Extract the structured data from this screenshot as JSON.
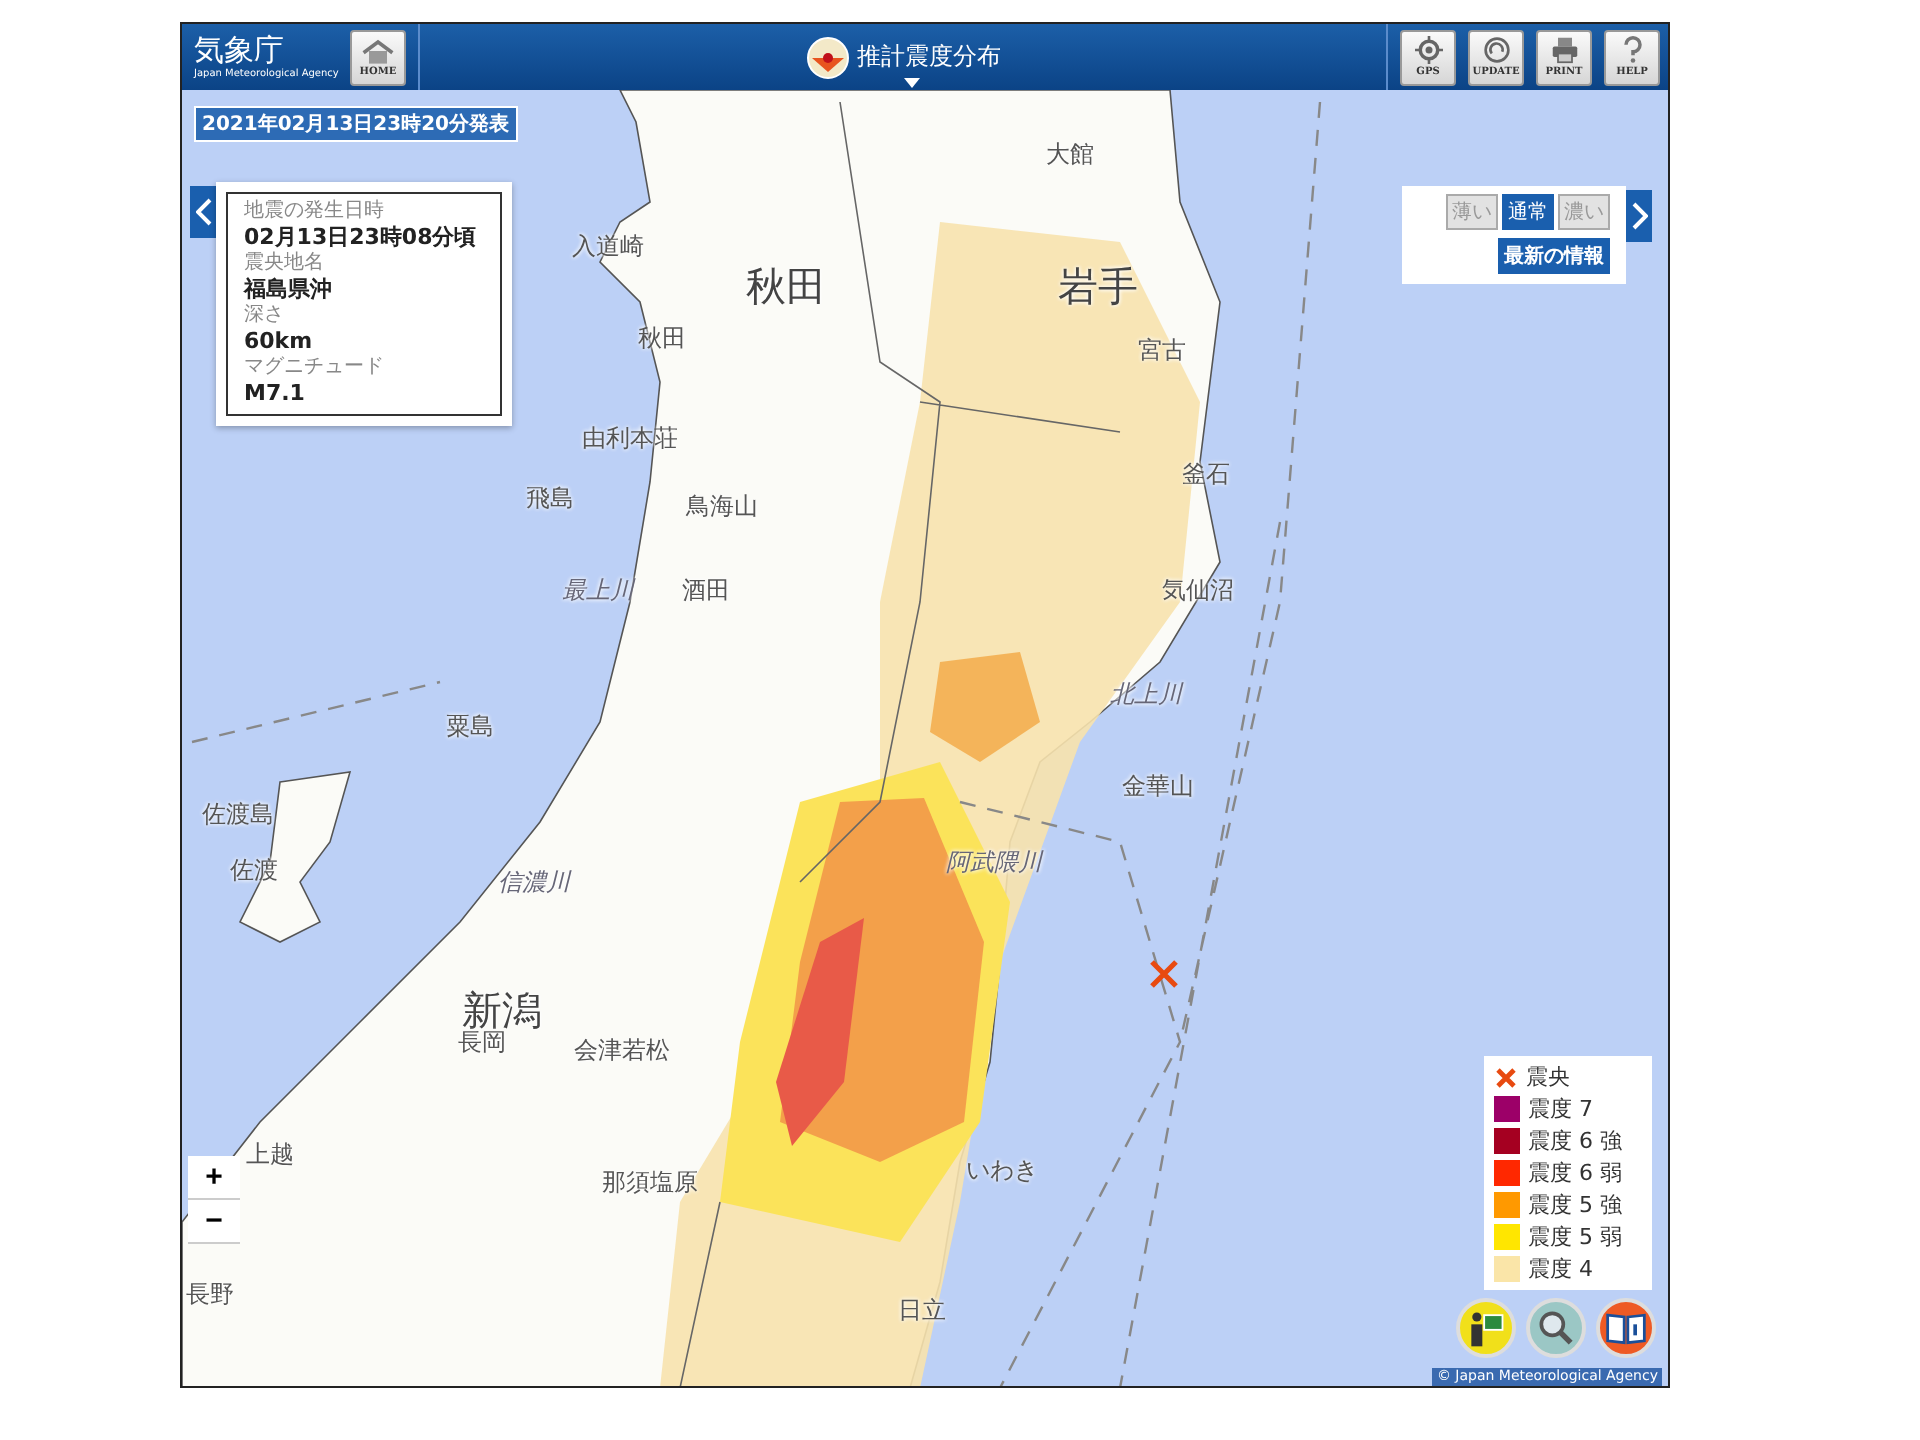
{
  "header": {
    "logo": {
      "name": "気象庁",
      "subtitle": "Japan Meteorological Agency"
    },
    "home_button": "HOME",
    "title": "推計震度分布",
    "tool_buttons": [
      {
        "kind": "gps",
        "label": "GPS"
      },
      {
        "kind": "update",
        "label": "UPDATE"
      },
      {
        "kind": "print",
        "label": "PRINT"
      },
      {
        "kind": "help",
        "label": "HELP"
      }
    ]
  },
  "issued": "2021年02月13日23時20分発表",
  "info_panel": {
    "fields": [
      {
        "label": "地震の発生日時",
        "value": "02月13日23時08分頃"
      },
      {
        "label": "震央地名",
        "value": "福島県沖"
      },
      {
        "label": "深さ",
        "value": "60km"
      },
      {
        "label": "マグニチュード",
        "value": "M7.1"
      }
    ]
  },
  "display_panel": {
    "shades": [
      {
        "label": "薄い",
        "selected": false
      },
      {
        "label": "通常",
        "selected": true
      },
      {
        "label": "濃い",
        "selected": false
      }
    ],
    "latest_button": "最新の情報"
  },
  "map": {
    "labels": [
      {
        "text": "大館",
        "kind": "city"
      },
      {
        "text": "入道崎",
        "kind": "city"
      },
      {
        "text": "秋田",
        "kind": "region"
      },
      {
        "text": "岩手",
        "kind": "region"
      },
      {
        "text": "秋田",
        "kind": "city"
      },
      {
        "text": "宮古",
        "kind": "city"
      },
      {
        "text": "由利本荘",
        "kind": "city"
      },
      {
        "text": "釜石",
        "kind": "city"
      },
      {
        "text": "飛島",
        "kind": "city"
      },
      {
        "text": "鳥海山",
        "kind": "city"
      },
      {
        "text": "最上川",
        "kind": "river"
      },
      {
        "text": "酒田",
        "kind": "city"
      },
      {
        "text": "気仙沼",
        "kind": "city"
      },
      {
        "text": "北上川",
        "kind": "river"
      },
      {
        "text": "粟島",
        "kind": "city"
      },
      {
        "text": "金華山",
        "kind": "city"
      },
      {
        "text": "佐渡島",
        "kind": "city"
      },
      {
        "text": "阿武隈川",
        "kind": "river"
      },
      {
        "text": "佐渡",
        "kind": "city"
      },
      {
        "text": "信濃川",
        "kind": "river"
      },
      {
        "text": "新潟",
        "kind": "region"
      },
      {
        "text": "長岡",
        "kind": "city"
      },
      {
        "text": "会津若松",
        "kind": "city"
      },
      {
        "text": "上越",
        "kind": "city"
      },
      {
        "text": "那須塩原",
        "kind": "city"
      },
      {
        "text": "いわき",
        "kind": "city"
      },
      {
        "text": "長野",
        "kind": "city"
      },
      {
        "text": "日立",
        "kind": "city"
      }
    ],
    "zoom_buttons": [
      "+",
      "−"
    ]
  },
  "legend": [
    {
      "kind": "epicenter",
      "label": "震央"
    },
    {
      "kind": "intensity",
      "label": "震度 7",
      "color": "#9c0068"
    },
    {
      "kind": "intensity",
      "label": "震度 6 強",
      "color": "#a50021"
    },
    {
      "kind": "intensity",
      "label": "震度 6 弱",
      "color": "#ff2800"
    },
    {
      "kind": "intensity",
      "label": "震度 5 強",
      "color": "#ff9900"
    },
    {
      "kind": "intensity",
      "label": "震度 5 弱",
      "color": "#ffe600"
    },
    {
      "kind": "intensity",
      "label": "震度 4",
      "color": "#fae5a8"
    }
  ],
  "copyright": "© Japan Meteorological Agency"
}
